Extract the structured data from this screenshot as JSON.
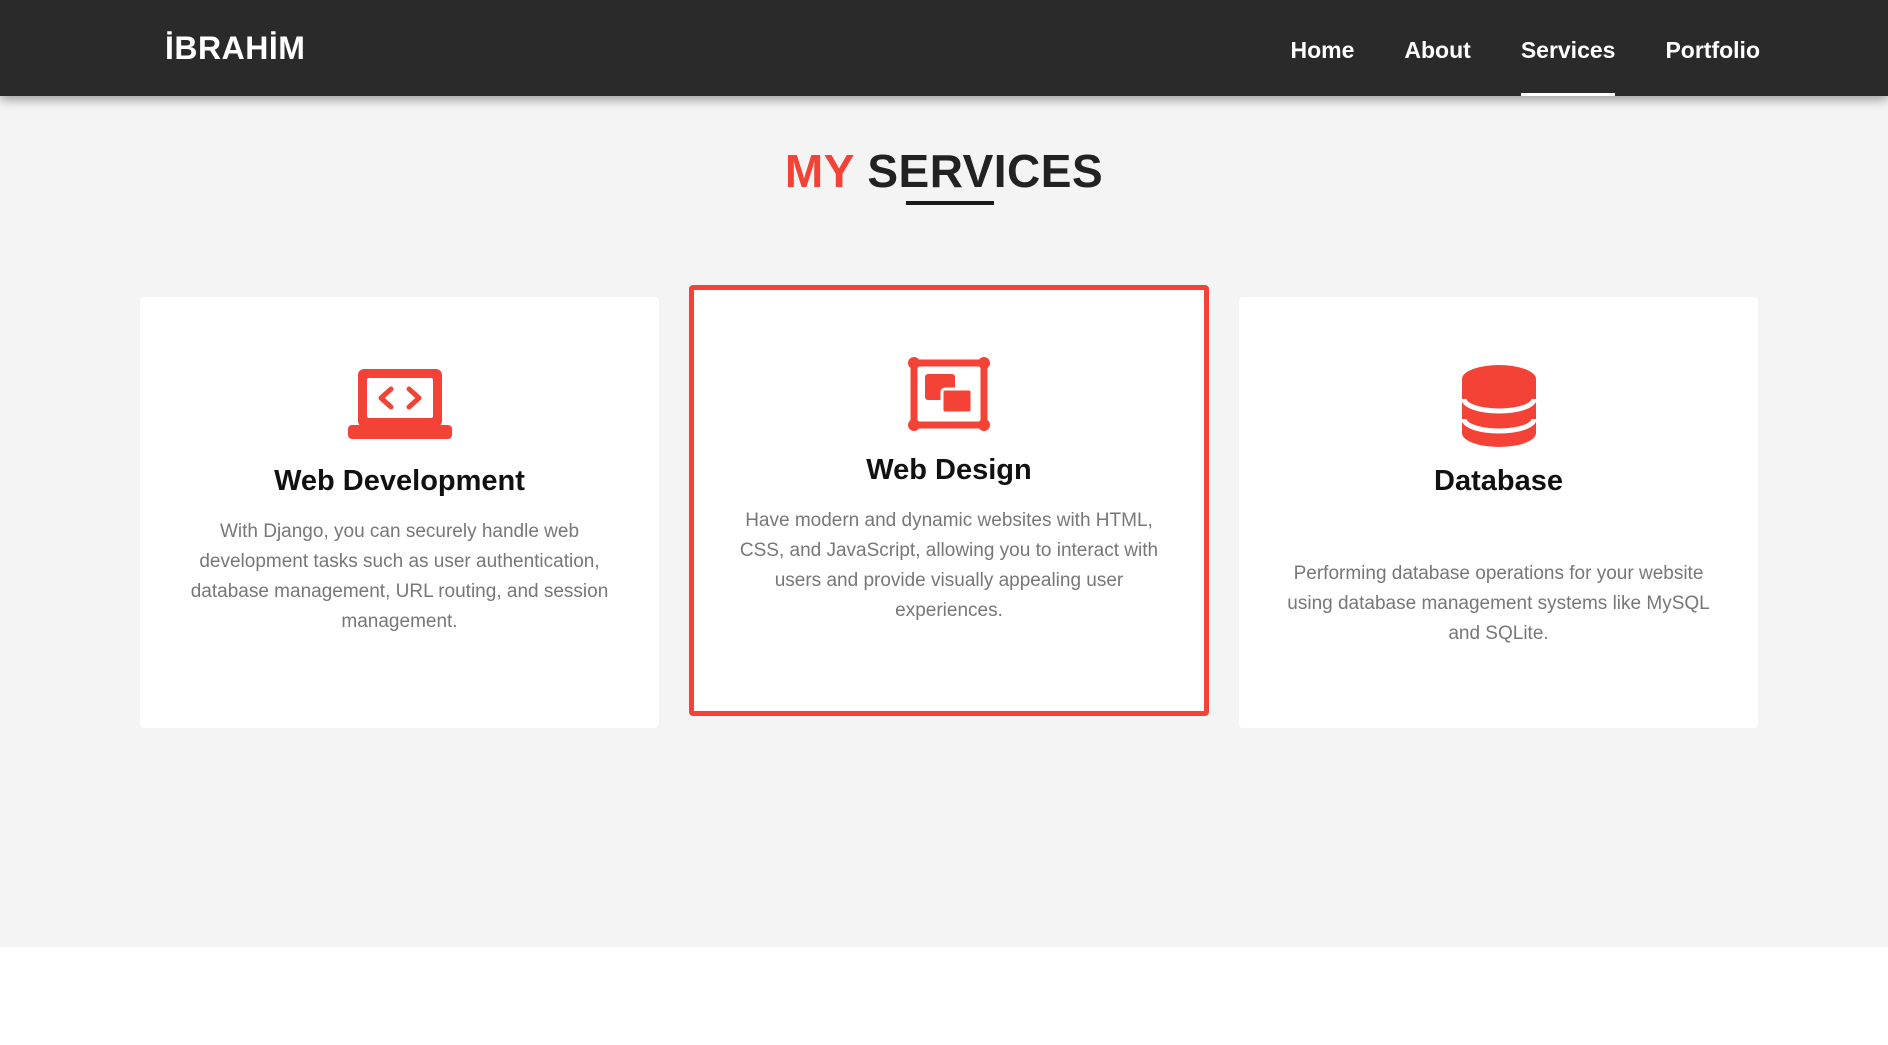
{
  "nav": {
    "brand": "İBRAHİM",
    "links": [
      "Home",
      "About",
      "Services",
      "Portfolio"
    ],
    "active": "Services"
  },
  "section": {
    "title_accent": "MY",
    "title_main": "SERVICES"
  },
  "cards": [
    {
      "icon": "laptop-code-icon",
      "title": "Web Development",
      "description": "With Django, you can securely handle web development tasks such as user authentication, database management, URL routing, and session management."
    },
    {
      "icon": "object-group-icon",
      "title": "Web Design",
      "description": "Have modern and dynamic websites with HTML, CSS, and JavaScript, allowing you to interact with users and provide visually appealing user experiences."
    },
    {
      "icon": "database-icon",
      "title": "Database",
      "description": "Performing database operations for your website using database management systems like MySQL and SQLite."
    }
  ],
  "colors": {
    "accent": "#f44336",
    "navbar": "#2a2a2a",
    "section_bg": "#f4f4f4"
  }
}
